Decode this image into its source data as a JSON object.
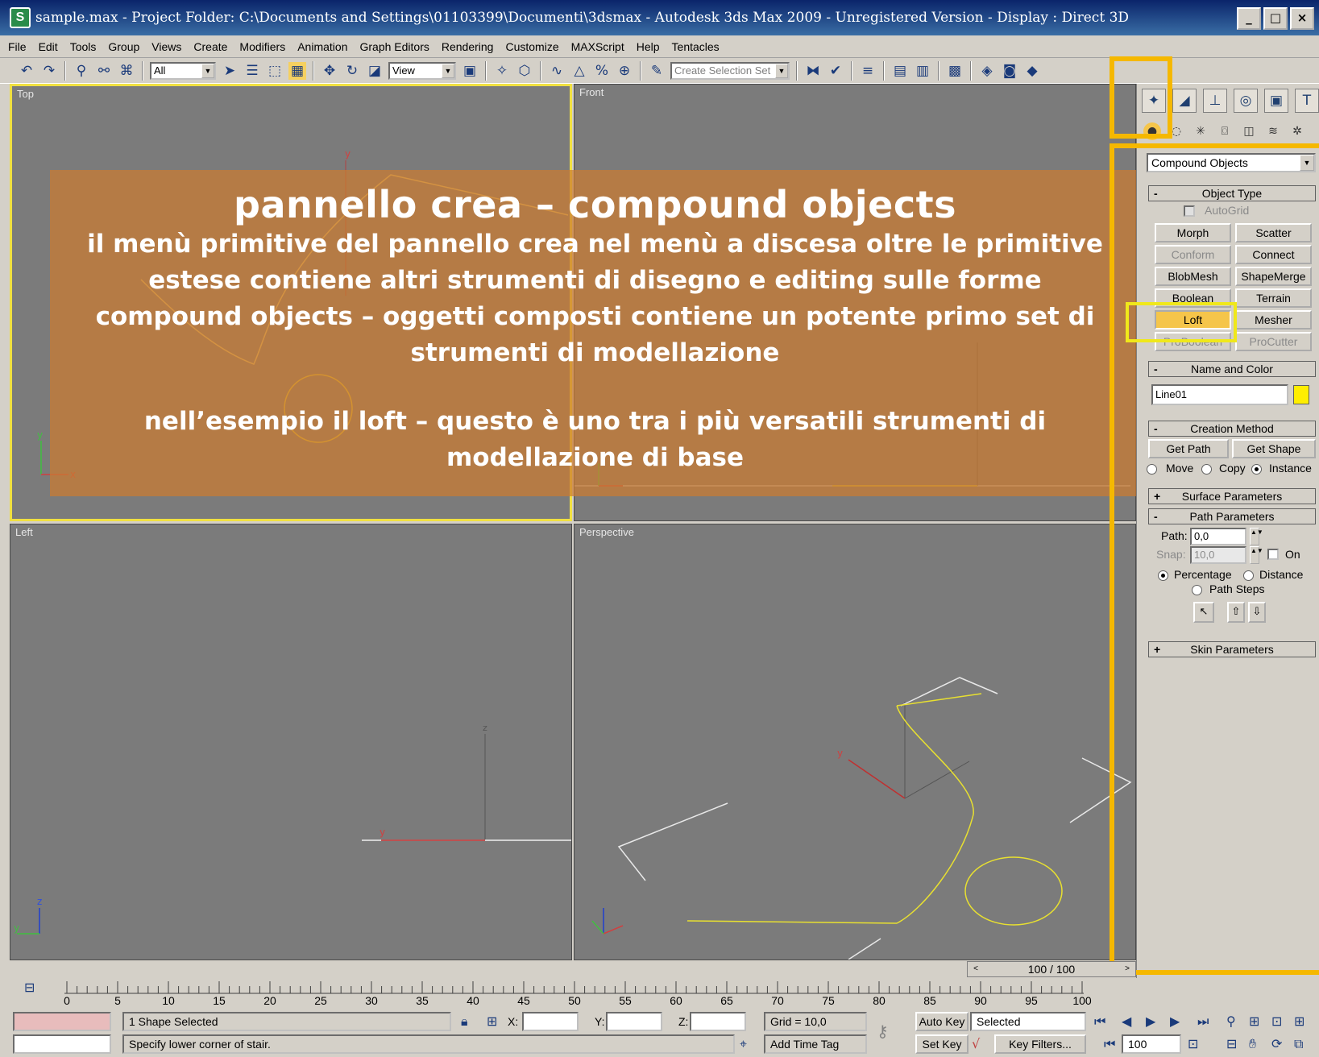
{
  "window": {
    "title": "sample.max    - Project Folder: C:\\Documents and Settings\\01103399\\Documenti\\3dsmax     - Autodesk 3ds Max  2009  - Unregistered Version      - Display : Direct 3D",
    "app_icon": "3ds-max-icon",
    "buttons": [
      "minimize-icon",
      "maximize-icon",
      "close-icon"
    ]
  },
  "menubar": [
    "File",
    "Edit",
    "Tools",
    "Group",
    "Views",
    "Create",
    "Modifiers",
    "Animation",
    "Graph Editors",
    "Rendering",
    "Customize",
    "MAXScript",
    "Help",
    "Tentacles"
  ],
  "toolbar": {
    "selection_filter": "All",
    "ref_coord": "View",
    "named_selection": "Create Selection Set"
  },
  "viewports": {
    "top": "Top",
    "front": "Front",
    "left": "Left",
    "perspective": "Perspective"
  },
  "overlay": {
    "title": "pannello crea – compound objects",
    "line1": "il menù primitive del pannello crea  nel menù a discesa oltre le primitive estese contiene altri strumenti di disegno e editing sulle forme",
    "line2": "compound objects – oggetti composti contiene un potente primo set di strumenti di modellazione",
    "line3": "nell’esempio il loft – questo è uno tra i più versatili strumenti di modellazione di base"
  },
  "command_panel": {
    "category": "Compound Objects",
    "object_type": {
      "header": "Object Type",
      "autogrid": "AutoGrid",
      "buttons": [
        "Morph",
        "Scatter",
        "Conform",
        "Connect",
        "BlobMesh",
        "ShapeMerge",
        "Boolean",
        "Terrain",
        "Loft",
        "Mesher",
        "ProBoolean",
        "ProCutter"
      ],
      "active": "Loft"
    },
    "name_color": {
      "header": "Name and Color",
      "name": "Line01",
      "color": "#ffee00"
    },
    "creation_method": {
      "header": "Creation Method",
      "get_path": "Get Path",
      "get_shape": "Get Shape",
      "move": "Move",
      "copy": "Copy",
      "instance": "Instance"
    },
    "surface_parameters": "Surface Parameters",
    "path_parameters": {
      "header": "Path Parameters",
      "path_label": "Path:",
      "path_value": "0,0",
      "snap_label": "Snap:",
      "snap_value": "10,0",
      "on": "On",
      "percentage": "Percentage",
      "distance": "Distance",
      "path_steps": "Path Steps"
    },
    "skin_parameters": "Skin Parameters"
  },
  "timeline": {
    "frame": "100 / 100",
    "ticks": [
      "0",
      "5",
      "10",
      "15",
      "20",
      "25",
      "30",
      "35",
      "40",
      "45",
      "50",
      "55",
      "60",
      "65",
      "70",
      "75",
      "80",
      "85",
      "90",
      "95",
      "100"
    ]
  },
  "status": {
    "selected": "1 Shape Selected",
    "prompt": "Specify lower corner of stair.",
    "x_label": "X:",
    "y_label": "Y:",
    "z_label": "Z:",
    "grid": "Grid = 10,0",
    "add_time_tag": "Add Time Tag",
    "auto_key": "Auto Key",
    "set_key": "Set Key",
    "key_mode": "Selected",
    "key_filters": "Key Filters...",
    "frame_value": "100"
  }
}
